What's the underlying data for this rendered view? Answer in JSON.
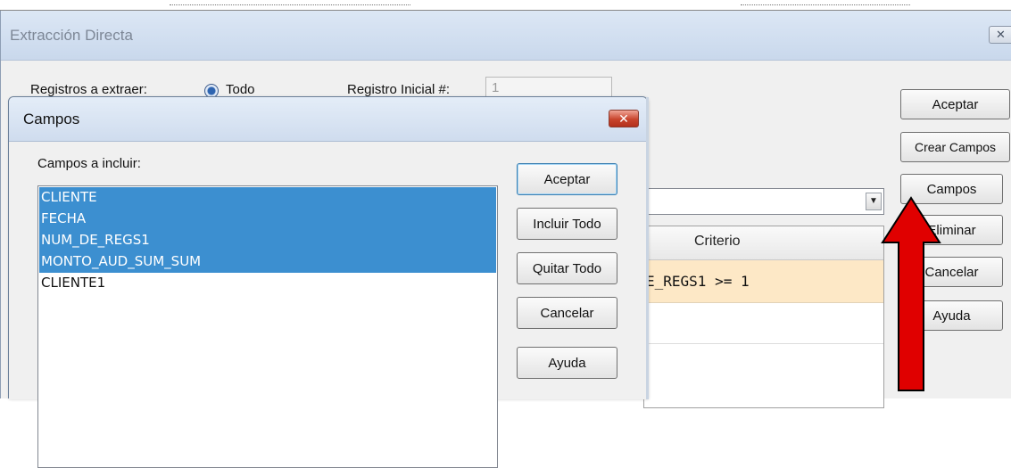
{
  "main": {
    "title": "Extracción Directa",
    "close_icon": "close-icon",
    "registros_label": "Registros a extraer:",
    "todo_label": "Todo",
    "registro_inicial_label": "Registro Inicial #:",
    "registro_inicial_value": "1",
    "buttons": {
      "aceptar": "Aceptar",
      "crear_campos": "Crear Campos",
      "campos": "Campos",
      "eliminar": "Eliminar",
      "cancelar": "Cancelar",
      "ayuda": "Ayuda"
    },
    "grid": {
      "header": "Criterio",
      "row1": "E_REGS1 >= 1"
    },
    "combo_icon": "chevron-down-icon"
  },
  "dialog": {
    "title": "Campos",
    "close_icon": "close-icon",
    "campos_label": "Campos a incluir:",
    "fields": [
      {
        "name": "CLIENTE",
        "selected": true
      },
      {
        "name": "FECHA",
        "selected": true
      },
      {
        "name": "NUM_DE_REGS1",
        "selected": true
      },
      {
        "name": "MONTO_AUD_SUM_SUM",
        "selected": true
      },
      {
        "name": "CLIENTE1",
        "selected": false
      }
    ],
    "buttons": {
      "aceptar": "Aceptar",
      "incluir_todo": "Incluir Todo",
      "quitar_todo": "Quitar Todo",
      "cancelar": "Cancelar",
      "ayuda": "Ayuda"
    }
  },
  "annotation": {
    "arrow_icon": "arrow-up-icon",
    "color": "#e00000"
  }
}
